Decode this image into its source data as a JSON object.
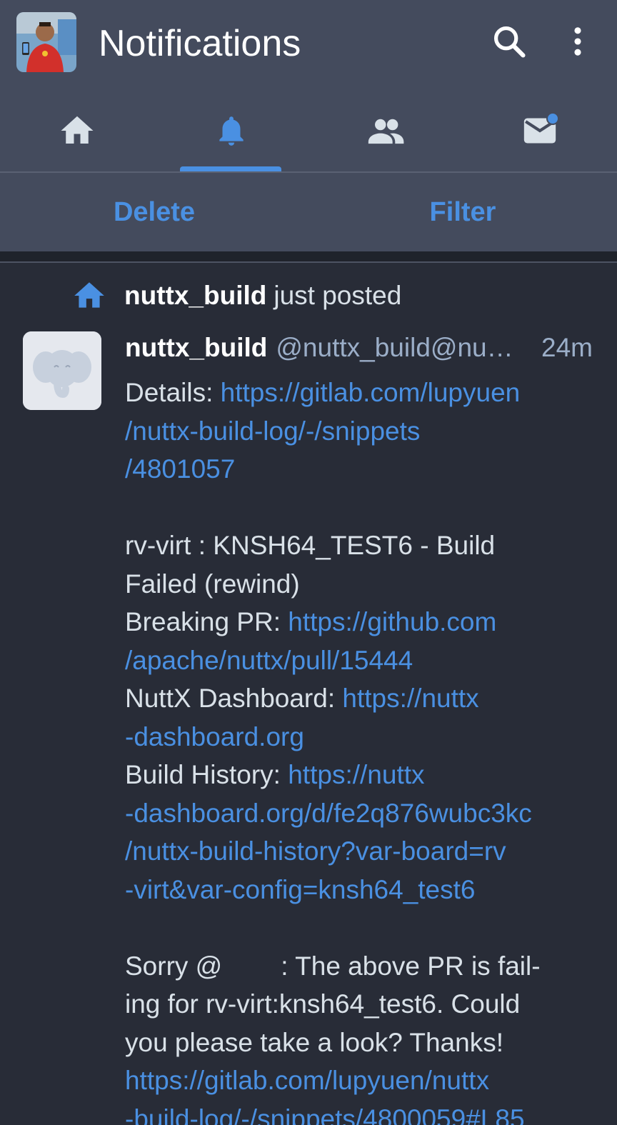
{
  "header": {
    "title": "Notifications",
    "search_icon": "search-icon",
    "menu_icon": "more-vert-icon"
  },
  "tabs": [
    {
      "name": "home",
      "icon": "home-icon",
      "active": false
    },
    {
      "name": "notifications",
      "icon": "bell-icon",
      "active": true
    },
    {
      "name": "local",
      "icon": "people-icon",
      "active": false
    },
    {
      "name": "direct",
      "icon": "mail-icon",
      "active": false,
      "unread": true
    }
  ],
  "actions": {
    "delete_label": "Delete",
    "filter_label": "Filter"
  },
  "notification": {
    "prepend_user": "nuttx_build",
    "prepend_text": "just posted",
    "status": {
      "display_name": "nuttx_build",
      "acct": "@nuttx_build@nu…",
      "time": "24m",
      "content": {
        "details_label": "Details: ",
        "details_link_1": "https://gitlab.com/lupyuen",
        "details_link_2": "/nuttx-build-log/-/snippets",
        "details_link_3": "/4801057",
        "title_line_1": "rv-virt : KNSH64_TEST6 - Build",
        "title_line_2": "Failed (rewind)",
        "breaking_label": "Breaking PR: ",
        "breaking_link_1": "https://github.com",
        "breaking_link_2": "/apache/nuttx/pull/15444",
        "dashboard_label": "NuttX Dashboard: ",
        "dashboard_link_1": "https://nuttx",
        "dashboard_link_2": "-dashboard.org",
        "history_label": "Build History: ",
        "history_link_1": "https://nuttx",
        "history_link_2": "-dashboard.org/d/fe2q876wubc3kc",
        "history_link_3": "/nuttx-build-history?var-board=rv",
        "history_link_4": "-virt&var-config=knsh64_test6",
        "sorry_prefix": "Sorry @",
        "sorry_rest": ": The above PR is fail-",
        "sorry_line_2": "ing for rv-virt:knsh64_test6. Could",
        "sorry_line_3": "you please take a look? Thanks!",
        "log_link_1": "https://gitlab.com/lupyuen/nuttx",
        "log_link_2": "-build-log/-/snippets/4800059#L85"
      }
    }
  },
  "colors": {
    "bar_bg": "#444b5d",
    "page_bg": "#282c37",
    "accent": "#4a90e2",
    "text": "#d9e1e8",
    "muted": "#9baec8"
  }
}
